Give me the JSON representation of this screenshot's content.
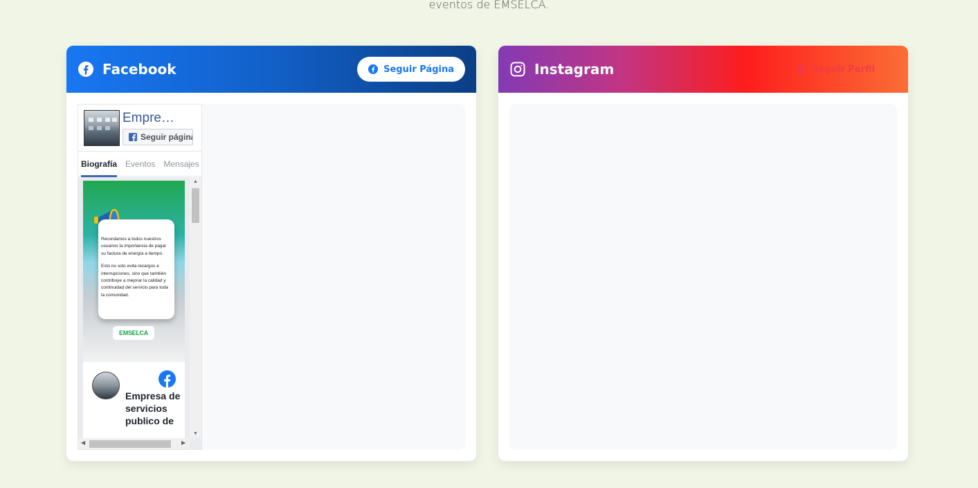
{
  "top_text": "eventos de EMSELCA.",
  "facebook": {
    "title": "Facebook",
    "follow_button": "Seguir Página",
    "widget": {
      "page_name": "Empre…",
      "follow": "Seguir página",
      "tabs": [
        "Biografía",
        "Eventos",
        "Mensajes"
      ],
      "post_text_1": "Recordamos a todos nuestros usuarios la importancia de pagar su factura de energía a tiempo.",
      "post_text_2": "Esto no solo evita recargos e interrupciones, sino que también contribuye a mejorar la calidad y continuidad del servicio para toda la comunidad.",
      "logo_text": "EMSELCA",
      "card_name": "Empresa de servicios publico de"
    }
  },
  "instagram": {
    "title": "Instagram",
    "follow_button": "Seguir Perfil"
  },
  "colors": {
    "background": "#f0f5e6",
    "facebook_blue": "#1877f2",
    "instagram_red": "#fd1d1d"
  }
}
